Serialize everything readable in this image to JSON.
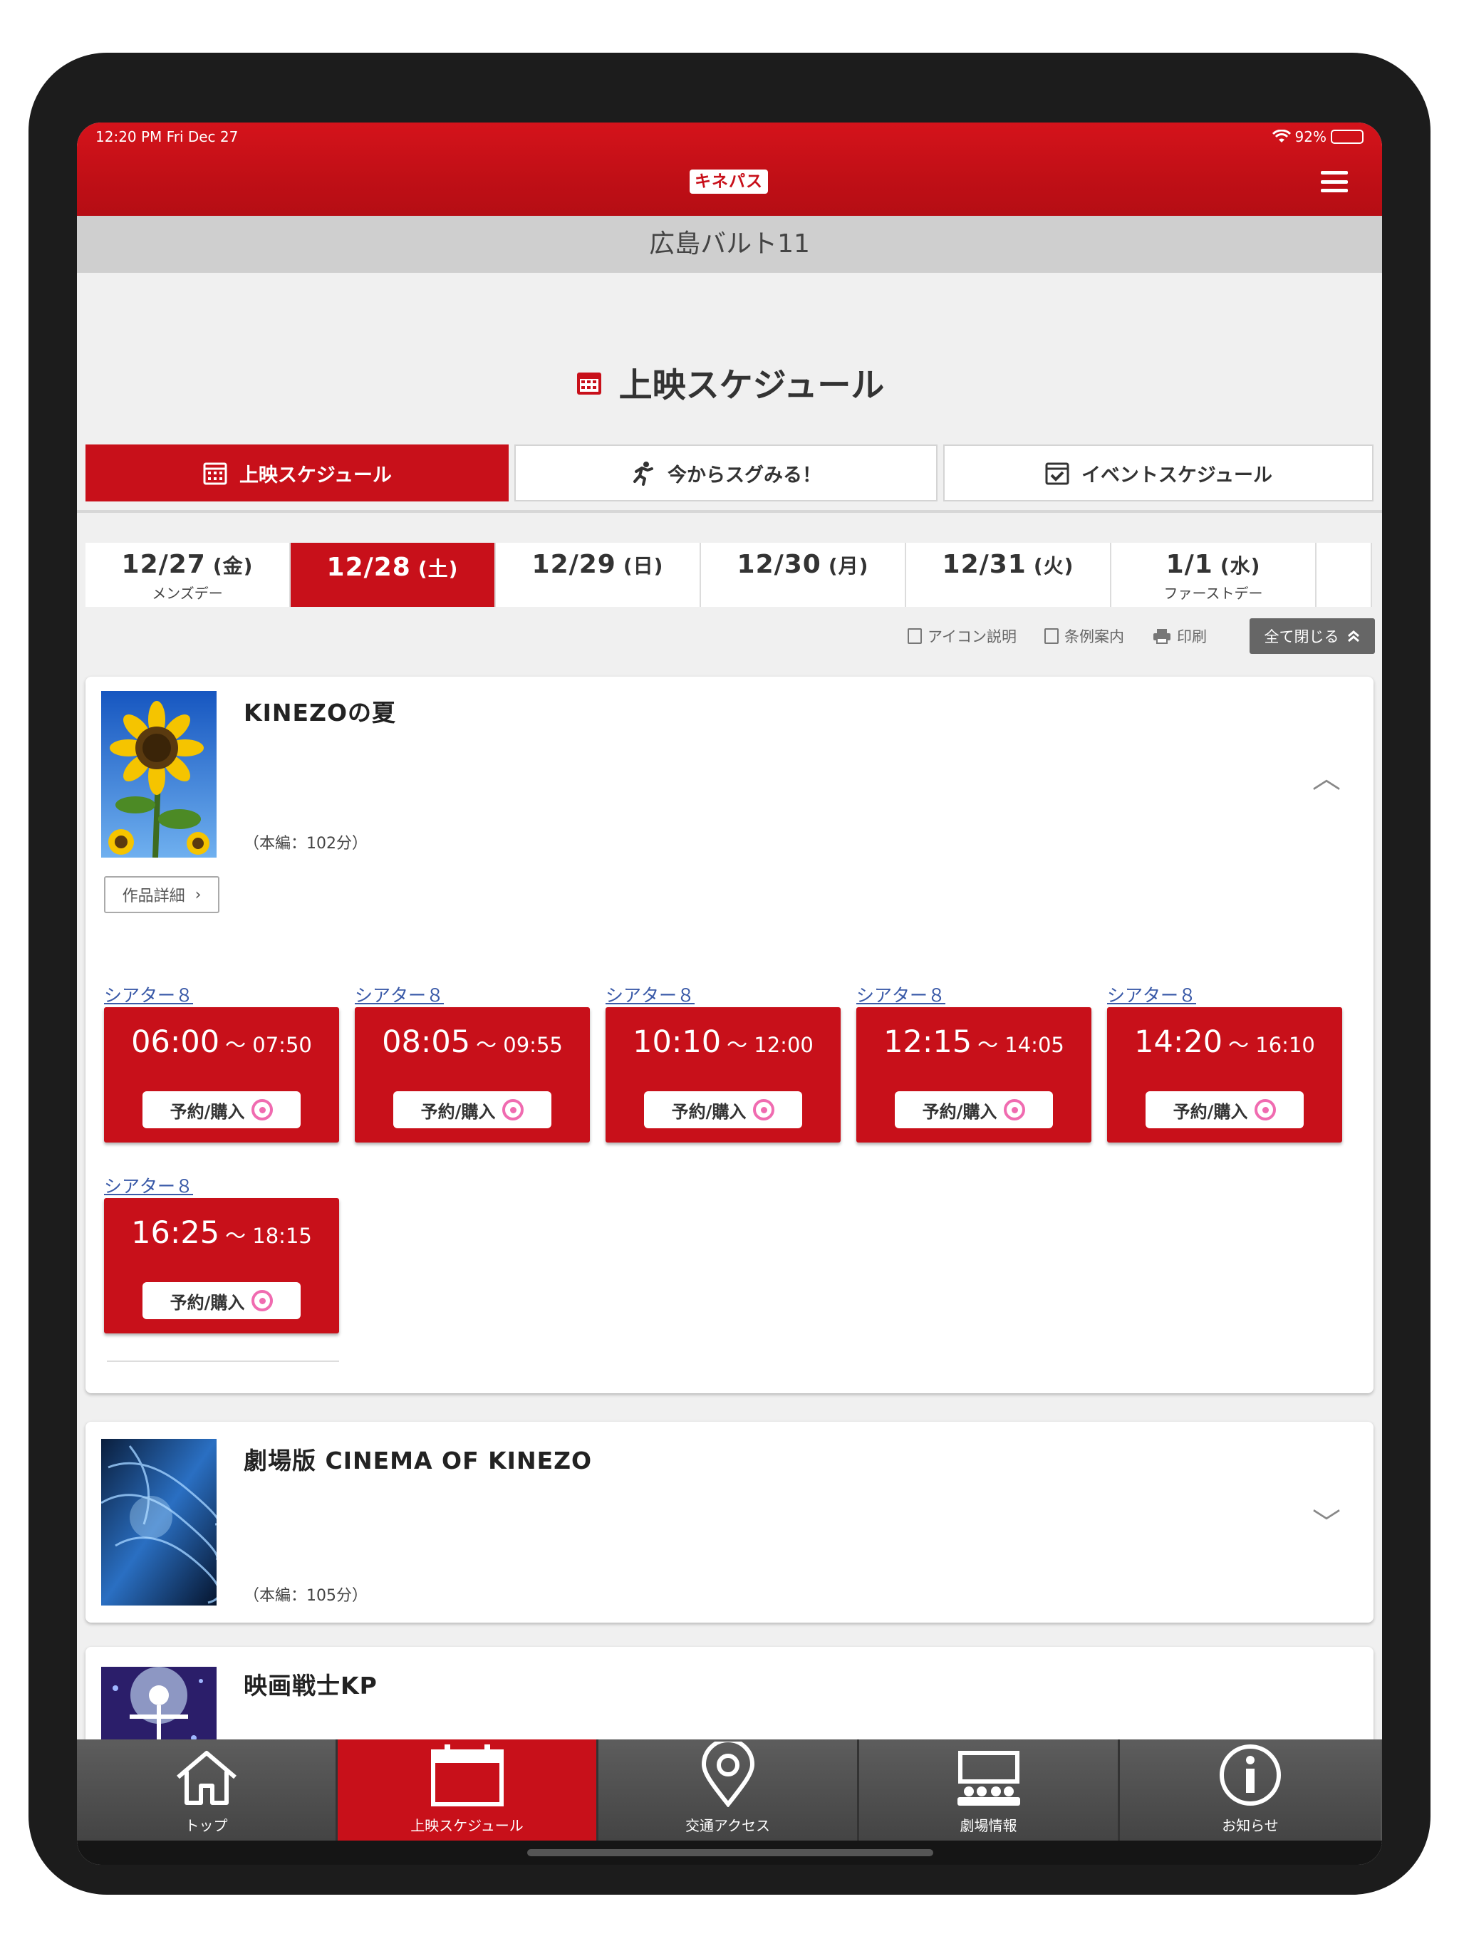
{
  "status_bar": {
    "time_date": "12:20 PM  Fri Dec 27",
    "battery": "92%"
  },
  "header": {
    "logo_text": "キネパス",
    "theater_name": "広島バルト11"
  },
  "page_title": "上映スケジュール",
  "mode_tabs": [
    {
      "label": "上映スケジュール",
      "icon": "calendar-icon",
      "active": true
    },
    {
      "label": "今からスグみる！",
      "icon": "running-person-icon",
      "active": false
    },
    {
      "label": "イベントスケジュール",
      "icon": "calendar-check-icon",
      "active": false
    }
  ],
  "date_tabs": [
    {
      "date": "12/27",
      "dow": "(金)",
      "sub": "メンズデー",
      "active": false
    },
    {
      "date": "12/28",
      "dow": "(土)",
      "sub": "",
      "active": true
    },
    {
      "date": "12/29",
      "dow": "(日)",
      "sub": "",
      "active": false
    },
    {
      "date": "12/30",
      "dow": "(月)",
      "sub": "",
      "active": false
    },
    {
      "date": "12/31",
      "dow": "(火)",
      "sub": "",
      "active": false
    },
    {
      "date": "1/1",
      "dow": "(水)",
      "sub": "ファーストデー",
      "active": false
    }
  ],
  "utility": {
    "icon_help": "アイコン説明",
    "rules": "条例案内",
    "print": "印刷",
    "close_all": "全て閉じる"
  },
  "movies": [
    {
      "title": "KINEZOの夏",
      "runtime": "（本編：102分）",
      "detail_label": "作品詳細",
      "expanded": true,
      "showtimes": [
        {
          "theater": "シアター８",
          "start": "06:00",
          "end": "～ 07:50",
          "button": "予約/購入"
        },
        {
          "theater": "シアター８",
          "start": "08:05",
          "end": "～ 09:55",
          "button": "予約/購入"
        },
        {
          "theater": "シアター８",
          "start": "10:10",
          "end": "～ 12:00",
          "button": "予約/購入"
        },
        {
          "theater": "シアター８",
          "start": "12:15",
          "end": "～ 14:05",
          "button": "予約/購入"
        },
        {
          "theater": "シアター８",
          "start": "14:20",
          "end": "～ 16:10",
          "button": "予約/購入"
        },
        {
          "theater": "シアター８",
          "start": "16:25",
          "end": "～ 18:15",
          "button": "予約/購入"
        }
      ]
    },
    {
      "title": "劇場版 CINEMA OF KINEZO",
      "runtime": "（本編：105分）",
      "expanded": false
    },
    {
      "title": "映画戦士KP",
      "expanded": false
    }
  ],
  "tab_bar": [
    {
      "label": "トップ",
      "icon": "home-icon",
      "active": false
    },
    {
      "label": "上映スケジュール",
      "icon": "calendar-icon",
      "active": true
    },
    {
      "label": "交通アクセス",
      "icon": "location-pin-icon",
      "active": false
    },
    {
      "label": "劇場情報",
      "icon": "theater-icon",
      "active": false
    },
    {
      "label": "お知らせ",
      "icon": "info-icon",
      "active": false
    }
  ],
  "colors": {
    "brand_red": "#c8101a",
    "link_blue": "#3a5aa8",
    "ticket_pink": "#f06bb0"
  }
}
